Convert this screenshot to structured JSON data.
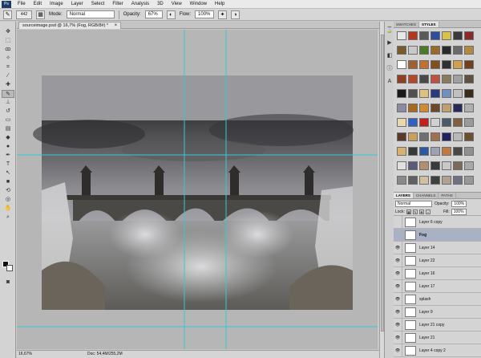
{
  "menubar": {
    "logo": "Ps",
    "items": [
      "File",
      "Edit",
      "Image",
      "Layer",
      "Select",
      "Filter",
      "Analysis",
      "3D",
      "View",
      "Window",
      "Help"
    ]
  },
  "options": {
    "brush_size": "442",
    "mode_label": "Mode:",
    "mode_value": "Normal",
    "opacity_label": "Opacity:",
    "opacity_value": "67%",
    "flow_label": "Flow:",
    "flow_value": "100%"
  },
  "document": {
    "tab_title": "sourceimage.psd @ 16,7% (Fog, RGB/8#) *",
    "close": "×"
  },
  "status": {
    "zoom": "16,67%",
    "doc_info": "Doc: 54,4M/255,2M"
  },
  "panel_tabs": {
    "top": [
      "SWATCHES",
      "STYLES"
    ],
    "top_active": "STYLES",
    "layers": [
      "LAYERS",
      "CHANNELS",
      "PATHS"
    ],
    "layers_active": "LAYERS"
  },
  "styles_colors": [
    "#e8e8e8",
    "#b5361f",
    "#5a5a5a",
    "#2c4e9c",
    "#d9c24a",
    "#3a3a3a",
    "#8a2a2a",
    "#7a5a2a",
    "#c9c9c9",
    "#4c7a2a",
    "#9a6a2a",
    "#2a2a2a",
    "#6a6a6a",
    "#b08a40",
    "#ffffff",
    "#a06030",
    "#c07030",
    "#805020",
    "#303030",
    "#d0a050",
    "#704020",
    "#904020",
    "#b04a2a",
    "#4a4a4a",
    "#c05040",
    "#8a7a60",
    "#a0a0a0",
    "#605040",
    "#1a1a1a",
    "#505050",
    "#e0c080",
    "#2a3a7a",
    "#7090c0",
    "#c0c0c0",
    "#3a2a1a",
    "#8a8aa0",
    "#a86a20",
    "#d08a30",
    "#6a4a2a",
    "#c0a070",
    "#2a2a5a",
    "#b0b0b0",
    "#e8d8b0",
    "#3060c0",
    "#c02020",
    "#d0d0d0",
    "#4a5a6a",
    "#806040",
    "#9a9a9a",
    "#5a3a2a",
    "#c8a060",
    "#707070",
    "#a07050",
    "#202060",
    "#b8b8b8",
    "#6a5030",
    "#d8b070",
    "#383838",
    "#2a5aa0",
    "#a0a0b0",
    "#c07a40",
    "#484848",
    "#909090",
    "#e0e0e0",
    "#5a5a7a",
    "#b09070",
    "#3a3a3a",
    "#c8c8c8",
    "#7a6a5a",
    "#a8a8a8",
    "#8a8a8a",
    "#606060",
    "#d0c0a0",
    "#404040",
    "#b0a090",
    "#707080",
    "#989898"
  ],
  "layers_panel": {
    "blend_mode": "Normal",
    "opacity_label": "Opacity:",
    "opacity_value": "100%",
    "lock_label": "Lock:",
    "fill_label": "Fill:",
    "fill_value": "100%",
    "items": [
      {
        "name": "Layer 6 copy",
        "visible": false,
        "selected": false
      },
      {
        "name": "Fog",
        "visible": false,
        "selected": true
      },
      {
        "name": "Layer 14",
        "visible": true,
        "selected": false
      },
      {
        "name": "Layer 22",
        "visible": true,
        "selected": false
      },
      {
        "name": "Layer 16",
        "visible": true,
        "selected": false
      },
      {
        "name": "Layer 17",
        "visible": true,
        "selected": false
      },
      {
        "name": "splash",
        "visible": true,
        "selected": false
      },
      {
        "name": "Layer 9",
        "visible": true,
        "selected": false
      },
      {
        "name": "Layer 21 copy",
        "visible": true,
        "selected": false
      },
      {
        "name": "Layer 21",
        "visible": true,
        "selected": false
      },
      {
        "name": "Layer 4 copy 2",
        "visible": true,
        "selected": false
      }
    ]
  },
  "colors": {
    "guide": "#35c8d8",
    "selection_highlight": "#a9b2c5"
  }
}
